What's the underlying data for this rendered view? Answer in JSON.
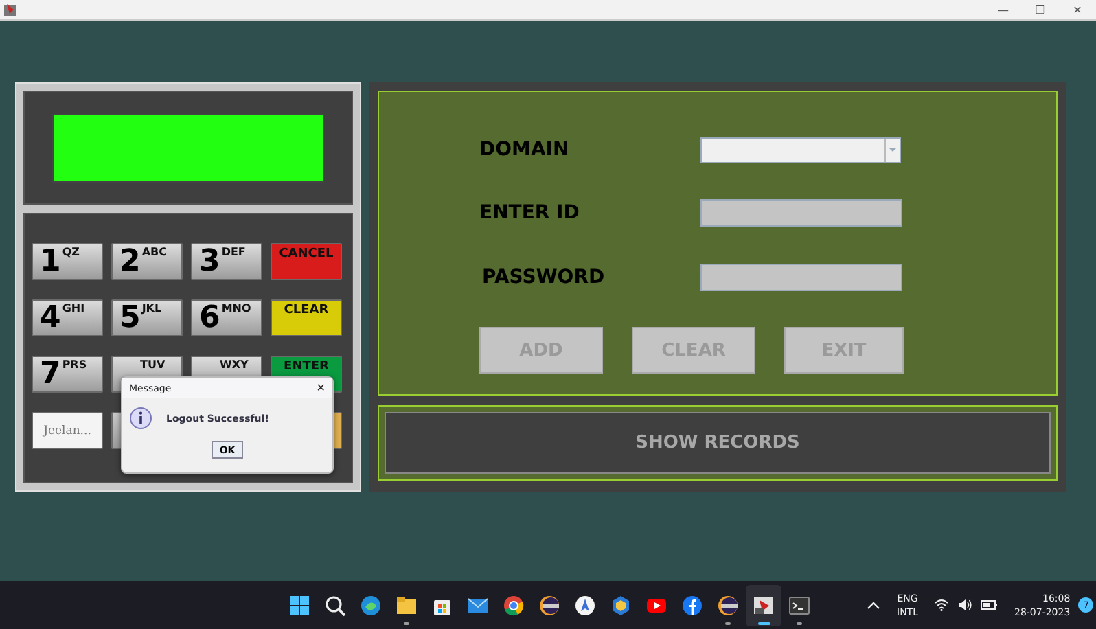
{
  "window": {
    "controls": [
      "—",
      "❐",
      "✕"
    ]
  },
  "keypad": {
    "keys": [
      {
        "kind": "digit",
        "label": "1",
        "letters": "QZ"
      },
      {
        "kind": "digit",
        "label": "2",
        "letters": "ABC"
      },
      {
        "kind": "digit",
        "label": "3",
        "letters": "DEF"
      },
      {
        "kind": "action",
        "label": "CANCEL",
        "color": "#d81c1c"
      },
      {
        "kind": "digit",
        "label": "4",
        "letters": "GHI"
      },
      {
        "kind": "digit",
        "label": "5",
        "letters": "JKL"
      },
      {
        "kind": "digit",
        "label": "6",
        "letters": "MNO"
      },
      {
        "kind": "action",
        "label": "CLEAR",
        "color": "#d8cc08"
      },
      {
        "kind": "digit",
        "label": "7",
        "letters": "PRS"
      },
      {
        "kind": "digit",
        "letters": "TUV"
      },
      {
        "kind": "digit",
        "letters": "WXY"
      },
      {
        "kind": "action",
        "label": "ENTER",
        "color": "#0a9a40"
      },
      {
        "kind": "name",
        "label": "Jeelan..."
      },
      {
        "kind": "blank"
      },
      {
        "kind": "action",
        "color": "#e0b050"
      }
    ]
  },
  "form": {
    "fields": [
      {
        "label": "DOMAIN",
        "kind": "dropdown"
      },
      {
        "label": "ENTER ID",
        "kind": "text"
      },
      {
        "label": "PASSWORD",
        "kind": "text"
      }
    ],
    "buttons": [
      "ADD",
      "CLEAR",
      "EXIT"
    ],
    "show_records": "SHOW RECORDS"
  },
  "dialog": {
    "title": "Message",
    "message": "Logout Successful!",
    "button": "OK",
    "close": "✕"
  },
  "taskbar": {
    "apps": [
      {
        "kind": "windows",
        "running": false,
        "active": false
      },
      {
        "kind": "search",
        "running": false,
        "active": false
      },
      {
        "kind": "edge",
        "running": false,
        "active": false
      },
      {
        "kind": "folder",
        "running": true,
        "active": false
      },
      {
        "kind": "store",
        "running": false,
        "active": false
      },
      {
        "kind": "mail",
        "running": false,
        "active": false
      },
      {
        "kind": "chrome",
        "running": false,
        "active": false
      },
      {
        "kind": "eclipse",
        "running": false,
        "active": false
      },
      {
        "kind": "compass",
        "running": false,
        "active": false
      },
      {
        "kind": "hexagon",
        "running": false,
        "active": false
      },
      {
        "kind": "youtube",
        "running": false,
        "active": false
      },
      {
        "kind": "facebook",
        "running": false,
        "active": false
      },
      {
        "kind": "eclipse",
        "running": true,
        "active": false
      },
      {
        "kind": "java",
        "running": true,
        "active": true
      },
      {
        "kind": "terminal",
        "running": true,
        "active": false
      }
    ],
    "language": [
      "ENG",
      "INTL"
    ],
    "time": "16:08",
    "date": "28-07-2023",
    "badge": "7"
  }
}
